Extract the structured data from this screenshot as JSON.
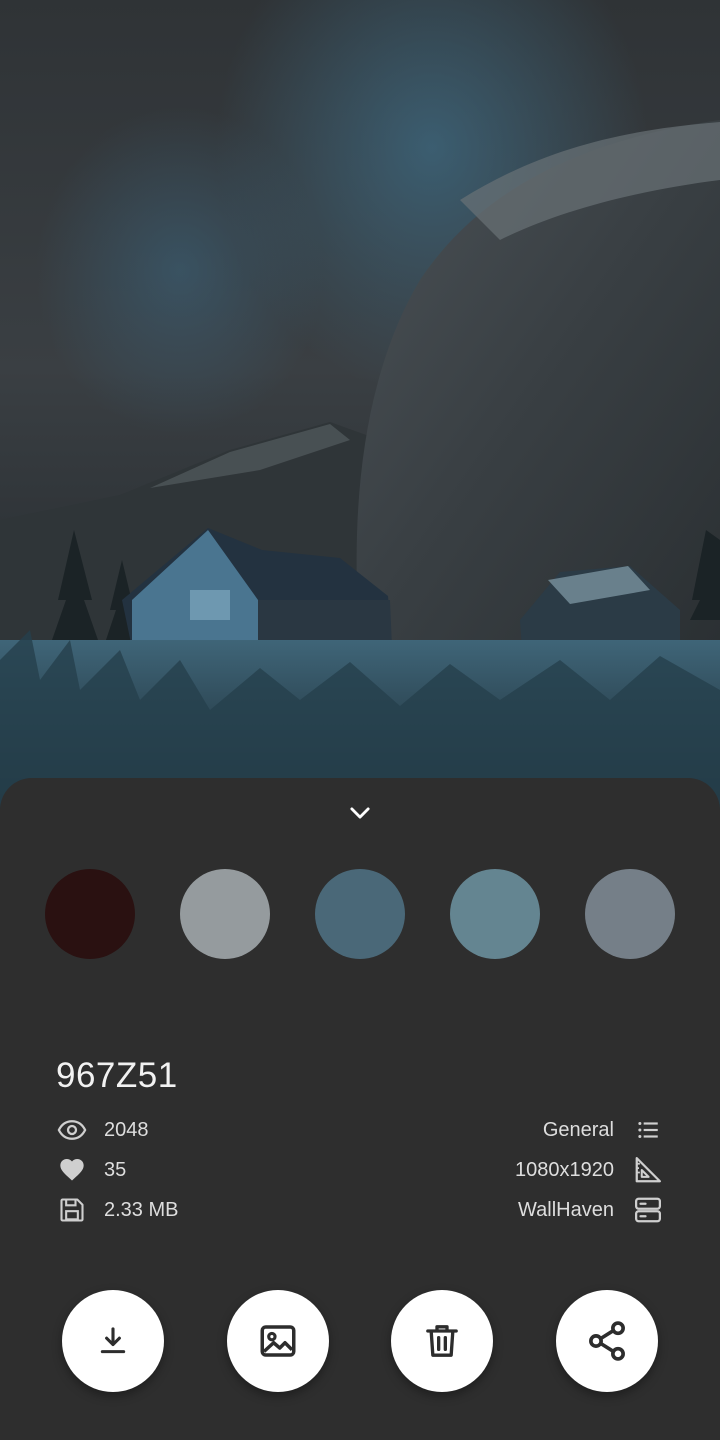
{
  "wallpaper": {
    "id": "967Z51",
    "colors": [
      "#2a1111",
      "#959b9e",
      "#4a6878",
      "#648591",
      "#757f88"
    ]
  },
  "stats": {
    "views": "2048",
    "favorites": "35",
    "file_size": "2.33 MB"
  },
  "meta": {
    "category": "General",
    "resolution": "1080x1920",
    "source": "WallHaven"
  },
  "icons": {
    "collapse": "chevron-down-icon",
    "views": "eye-icon",
    "favorites": "heart-icon",
    "size": "floppy-disk-icon",
    "category": "list-icon",
    "resolution": "set-square-icon",
    "source": "server-icon",
    "download": "download-icon",
    "set_wallpaper": "image-icon",
    "delete": "trash-icon",
    "share": "share-icon"
  }
}
